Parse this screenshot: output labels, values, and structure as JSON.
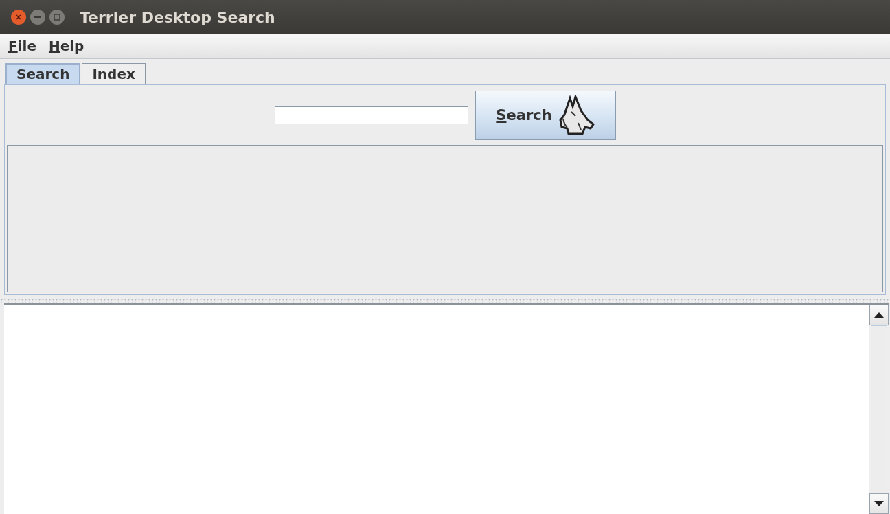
{
  "window": {
    "title": "Terrier Desktop Search"
  },
  "menu": [
    {
      "label": "File"
    },
    {
      "label": "Help"
    }
  ],
  "tabs": [
    {
      "label": "Search",
      "selected": true
    },
    {
      "label": "Index",
      "selected": false
    }
  ],
  "search": {
    "button": "Search"
  }
}
